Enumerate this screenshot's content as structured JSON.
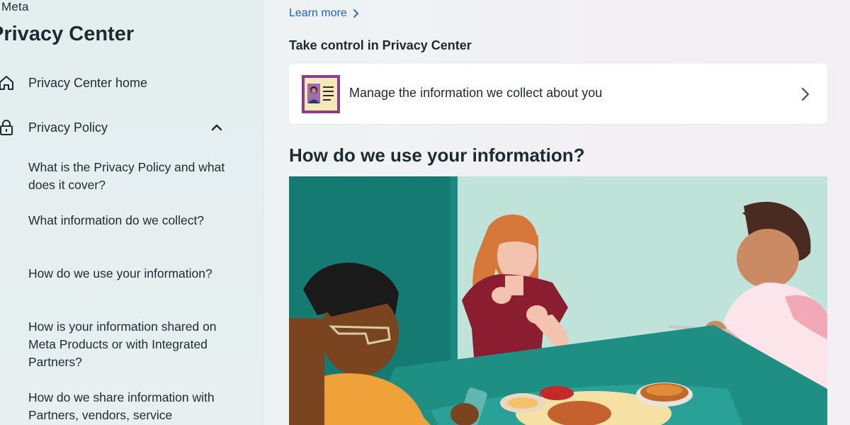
{
  "sidebar": {
    "brand": "Meta",
    "title": "Privacy Center",
    "items": [
      {
        "label": "Privacy Center home",
        "icon": "home-icon"
      },
      {
        "label": "Privacy Policy",
        "icon": "lock-icon",
        "expanded": true
      }
    ],
    "subitems": [
      "What is the Privacy Policy and what does it cover?",
      "What information do we collect?",
      "How do we use your information?",
      "How is your information shared on Meta Products or with Integrated Partners?",
      "How do we share information with Partners, vendors, service"
    ]
  },
  "main": {
    "learn_more": "Learn more",
    "section_label": "Take control in Privacy Center",
    "card": {
      "text": "Manage the information we collect about you",
      "icon": "id-card-icon"
    },
    "heading": "How do we use your information?"
  },
  "colors": {
    "link": "#1a5fd6",
    "text": "#1c2b33",
    "sidebar_bg": "#e4eeef",
    "illustration_teal": "#157a71",
    "illustration_mint": "#bfe3d8"
  }
}
